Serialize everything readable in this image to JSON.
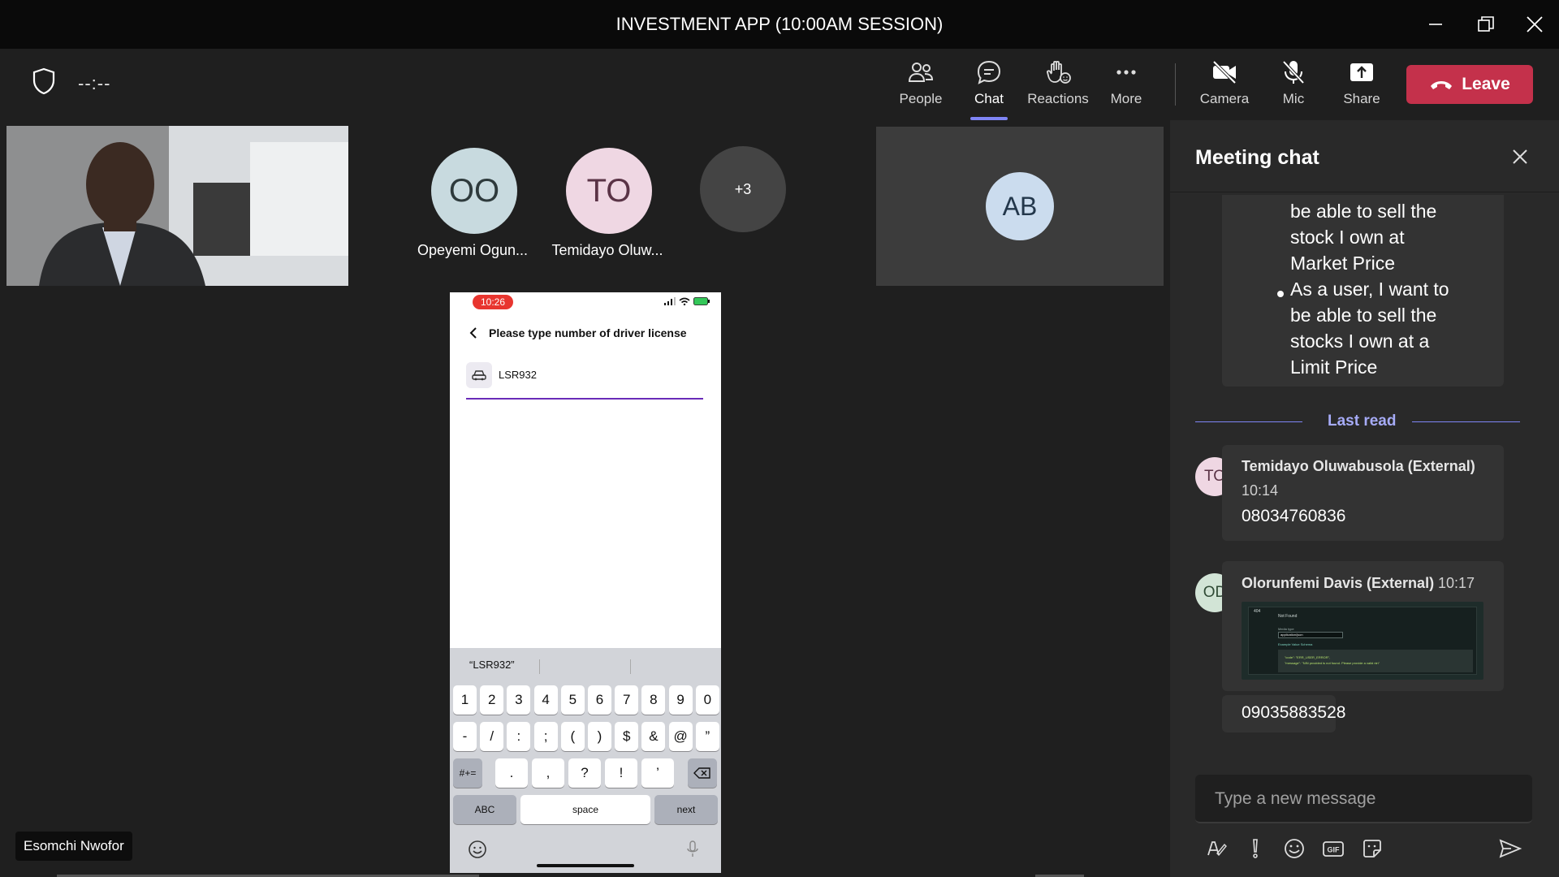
{
  "window": {
    "title": "INVESTMENT APP (10:00AM SESSION)"
  },
  "toolbar": {
    "timer": "--:--",
    "people_label": "People",
    "chat_label": "Chat",
    "reactions_label": "Reactions",
    "more_label": "More",
    "camera_label": "Camera",
    "mic_label": "Mic",
    "share_label": "Share",
    "leave_label": "Leave"
  },
  "participants": [
    {
      "initials": "OO",
      "name": "Opeyemi Ogun...",
      "color": "#c8dadf"
    },
    {
      "initials": "TO",
      "name": "Temidayo Oluw...",
      "color": "#efd7e3"
    },
    {
      "initials": "+3",
      "name": "",
      "color": "#444444"
    }
  ],
  "spotlight": {
    "initials": "AB",
    "color": "#cbdcee"
  },
  "video_name": "Esomchi Nwofor",
  "phone": {
    "time": "10:26",
    "header": "Please type number of driver license",
    "input_value": "LSR932",
    "suggestion": "“LSR932”",
    "row1": [
      "1",
      "2",
      "3",
      "4",
      "5",
      "6",
      "7",
      "8",
      "9",
      "0"
    ],
    "row2": [
      "-",
      "/",
      ":",
      ";",
      "(",
      ")",
      "$",
      "&",
      "@",
      "”"
    ],
    "row3_left": "#+=",
    "row3": [
      ".",
      ",",
      "?",
      "!",
      "’"
    ],
    "abc": "ABC",
    "space": "space",
    "next": "next"
  },
  "chat": {
    "title": "Meeting chat",
    "prior_lines_1": [
      "be able to sell the",
      "stock I own at",
      "Market Price"
    ],
    "prior_lines_2": [
      "As a user, I want to",
      "be able to sell the",
      "stocks I own at a",
      "Limit Price"
    ],
    "last_read": "Last read",
    "messages": [
      {
        "initials": "TO",
        "author": "Temidayo Oluwabusola (External)",
        "time": "10:14",
        "body": "08034760836",
        "avatar_color": "#efd7e3",
        "status_color": "#c4314b"
      },
      {
        "initials": "OD",
        "author": "Olorunfemi Davis (External)",
        "time": "10:17",
        "body": "09035883528",
        "avatar_color": "#d2e4d6",
        "status_color": "#8a8a8a"
      }
    ],
    "thumb_text": [
      "404",
      "Not Found",
      "Media type",
      "application/json",
      "Example Value  Schema",
      "\"code\": \"ERR_USER_ERROR\",",
      "\"message\": \"NIN provided is not found. Please provide a valid nin\""
    ],
    "compose_placeholder": "Type a new message"
  },
  "colors": {
    "accent": "#7f85f5",
    "leave": "#c4314b",
    "panel": "#292929",
    "stage": "#1f1f1f"
  }
}
